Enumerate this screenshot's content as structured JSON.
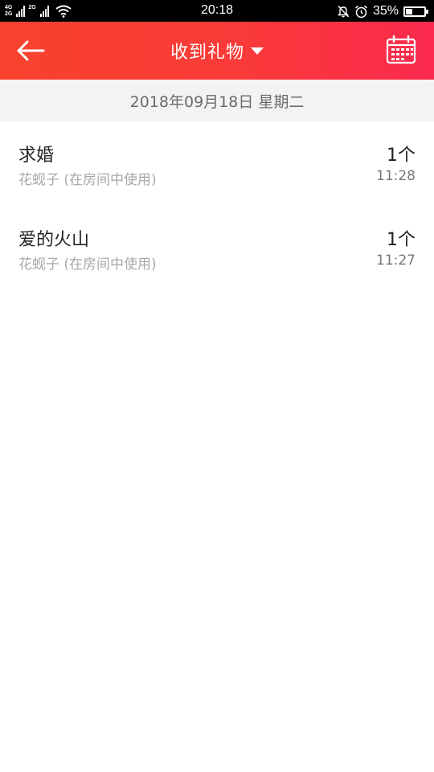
{
  "status_bar": {
    "network_top": "4G",
    "network_bottom": "2G",
    "network2": "2G",
    "time": "20:18",
    "battery_text": "35%",
    "battery_level": 0.35,
    "icons": [
      "signal-icon",
      "wifi-icon",
      "mute-icon",
      "alarm-icon",
      "battery-icon"
    ]
  },
  "header": {
    "title": "收到礼物",
    "back_icon": "arrow-left-icon",
    "dropdown_icon": "caret-down-icon",
    "calendar_icon": "calendar-icon",
    "background_colors": [
      "#f8422d",
      "#fb2a4e"
    ]
  },
  "date_bar": {
    "text": "2018年09月18日 星期二"
  },
  "gifts": [
    {
      "name": "求婚",
      "subtitle": "花蚬子 (在房间中使用)",
      "quantity": "1个",
      "time": "11:28"
    },
    {
      "name": "爱的火山",
      "subtitle": "花蚬子 (在房间中使用)",
      "quantity": "1个",
      "time": "11:27"
    }
  ]
}
